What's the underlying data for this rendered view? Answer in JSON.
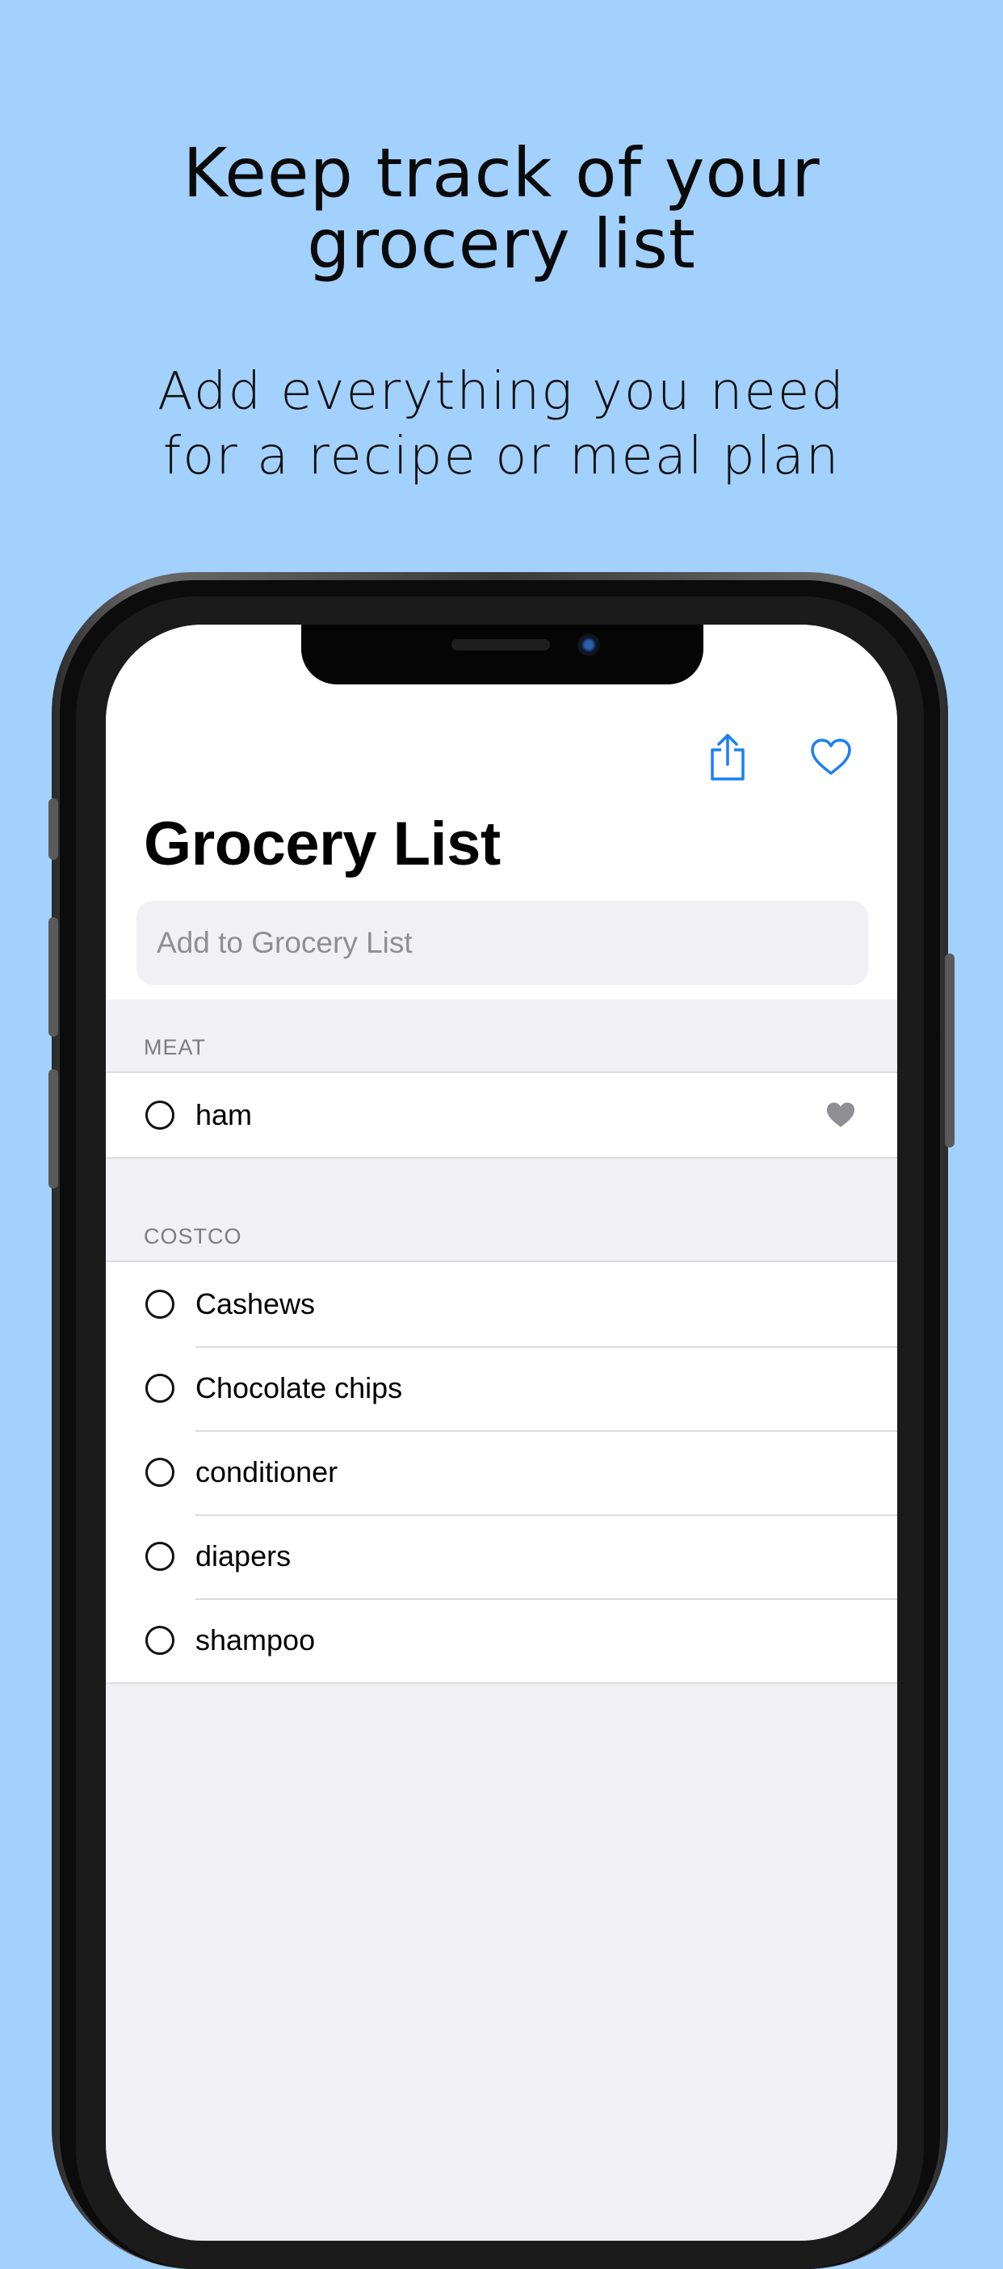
{
  "promo": {
    "headline_line1": "Keep track of your",
    "headline_line2": "grocery list",
    "subline_line1": "Add everything you need",
    "subline_line2": "for a recipe or meal plan"
  },
  "navbar": {
    "share_icon": "share-icon",
    "favorite_icon": "heart-outline-icon",
    "accent_color": "#1a7ff5"
  },
  "title": "Grocery List",
  "search": {
    "placeholder": "Add to Grocery List",
    "value": ""
  },
  "sections": [
    {
      "header": "MEAT",
      "items": [
        {
          "label": "ham",
          "favorited": true
        }
      ]
    },
    {
      "header": "COSTCO",
      "items": [
        {
          "label": "Cashews",
          "favorited": false
        },
        {
          "label": "Chocolate chips",
          "favorited": false
        },
        {
          "label": "conditioner",
          "favorited": false
        },
        {
          "label": "diapers",
          "favorited": false
        },
        {
          "label": "shampoo",
          "favorited": false
        }
      ]
    }
  ],
  "colors": {
    "page_background": "#a3d1fd",
    "list_background": "#f0f0f5",
    "favorite_heart": "#8e8e93"
  }
}
